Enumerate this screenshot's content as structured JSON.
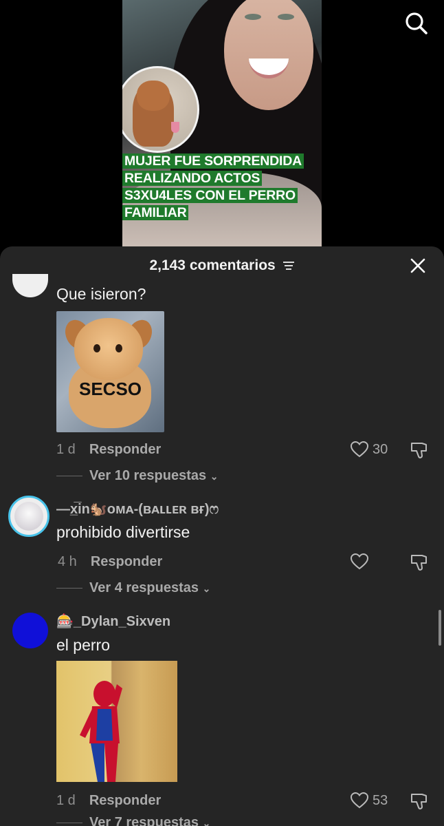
{
  "video": {
    "headline_lines": [
      "MUJER FUE SORPRENDIDA",
      "REALIZANDO ACTOS",
      "S3XU4LES CON EL PERRO",
      "FAMILIAR"
    ],
    "colors": {
      "headline_bg": "#1f7a2c"
    }
  },
  "icons": {
    "search": "search-icon",
    "close": "close-icon",
    "sort": "sort-icon",
    "heart": "heart-icon",
    "dislike": "dislike-icon"
  },
  "sheet": {
    "count_label": "2,143 comentarios"
  },
  "comments": [
    {
      "text": "Que isieron?",
      "sticker_text": "SECSO",
      "time": "1 d",
      "reply_label": "Responder",
      "likes": "30",
      "view_replies": "Ver 10 respuestas"
    },
    {
      "username": "—x̲̅in🐿️ᴏᴍᴀ-(ʙᴀʟʟᴇʀ ʙғ)ෆ",
      "text": "prohibido divertirse",
      "time": "4 h",
      "reply_label": "Responder",
      "likes": "",
      "view_replies": "Ver 4 respuestas"
    },
    {
      "username": "🎰_Dylan_Sixven",
      "text": "el perro",
      "time": "1 d",
      "reply_label": "Responder",
      "likes": "53",
      "view_replies": "Ver 7 respuestas"
    }
  ]
}
